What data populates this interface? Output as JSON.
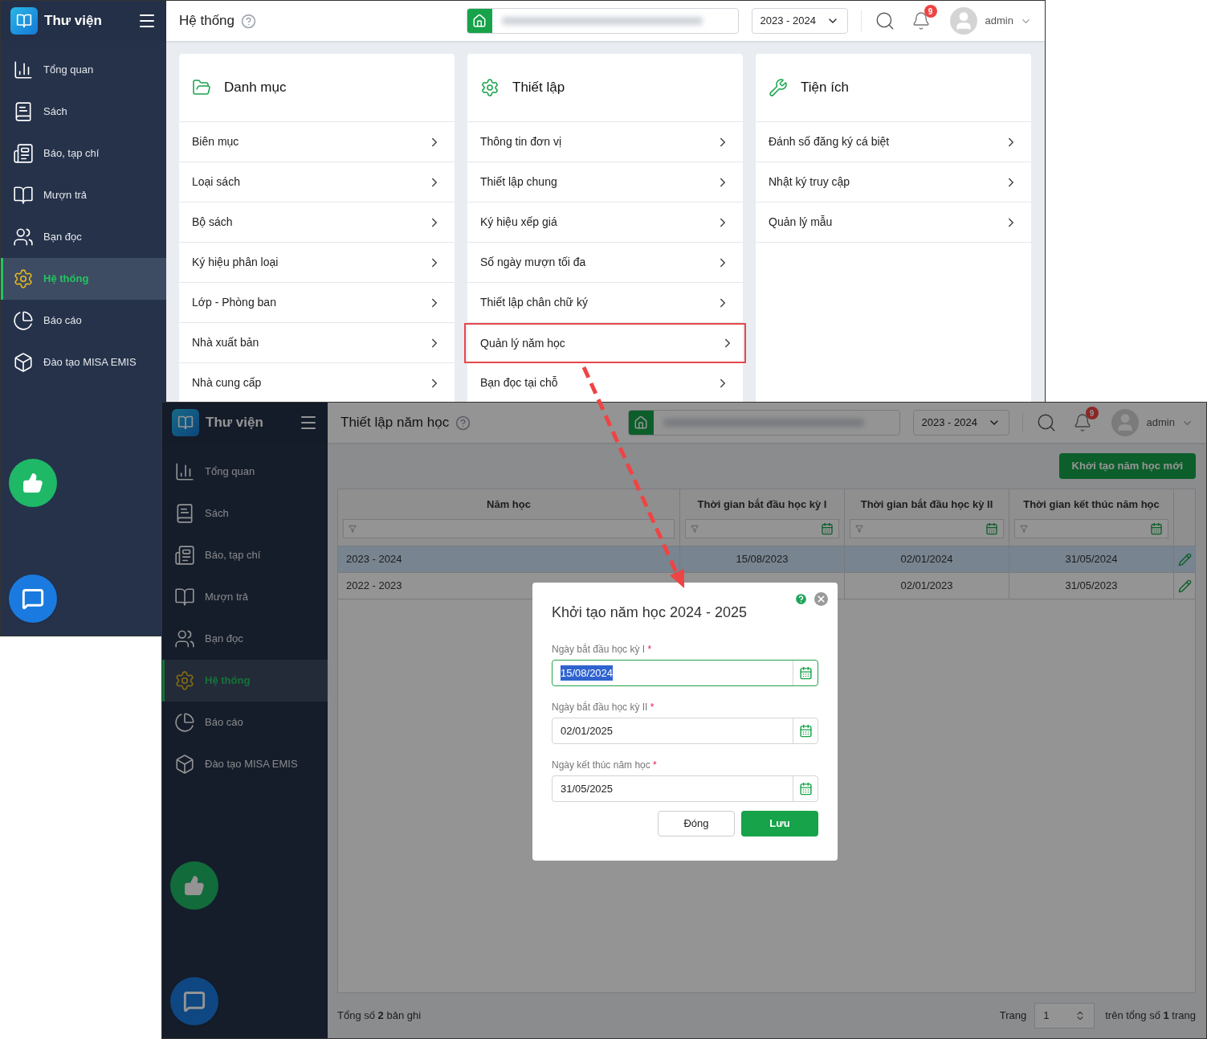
{
  "back_screen": {
    "app_title": "Thư viện",
    "page_title": "Hệ thống",
    "school_year": "2023 - 2024",
    "notification_count": "9",
    "user": "admin",
    "sidebar": [
      {
        "label": "Tổng quan",
        "selected": false
      },
      {
        "label": "Sách",
        "selected": false
      },
      {
        "label": "Báo, tạp chí",
        "selected": false
      },
      {
        "label": "Mượn trả",
        "selected": false
      },
      {
        "label": "Bạn đọc",
        "selected": false
      },
      {
        "label": "Hệ thống",
        "selected": true
      },
      {
        "label": "Báo cáo",
        "selected": false
      },
      {
        "label": "Đào tạo MISA EMIS",
        "selected": false
      }
    ],
    "cards": [
      {
        "title": "Danh mục",
        "rows": [
          {
            "label": "Biên mục",
            "highlighted": false
          },
          {
            "label": "Loại sách",
            "highlighted": false
          },
          {
            "label": "Bộ sách",
            "highlighted": false
          },
          {
            "label": "Ký hiệu phân loại",
            "highlighted": false
          },
          {
            "label": "Lớp - Phòng ban",
            "highlighted": false
          },
          {
            "label": "Nhà xuất bản",
            "highlighted": false
          },
          {
            "label": "Nhà cung cấp",
            "highlighted": false
          }
        ]
      },
      {
        "title": "Thiết lập",
        "rows": [
          {
            "label": "Thông tin đơn vị",
            "highlighted": false
          },
          {
            "label": "Thiết lập chung",
            "highlighted": false
          },
          {
            "label": "Ký hiệu xếp giá",
            "highlighted": false
          },
          {
            "label": "Số ngày mượn tối đa",
            "highlighted": false
          },
          {
            "label": "Thiết lập chân chữ ký",
            "highlighted": false
          },
          {
            "label": "Quản lý năm học",
            "highlighted": true
          },
          {
            "label": "Bạn đọc tại chỗ",
            "highlighted": false
          }
        ]
      },
      {
        "title": "Tiện ích",
        "rows": [
          {
            "label": "Đánh số đăng ký cá biệt",
            "highlighted": false
          },
          {
            "label": "Nhật ký truy cập",
            "highlighted": false
          },
          {
            "label": "Quản lý mẫu",
            "highlighted": false
          }
        ]
      }
    ]
  },
  "front_screen": {
    "app_title": "Thư viện",
    "page_title": "Thiết lập năm học",
    "school_year": "2023 - 2024",
    "notification_count": "9",
    "user": "admin",
    "sidebar": [
      {
        "label": "Tổng quan",
        "selected": false
      },
      {
        "label": "Sách",
        "selected": false
      },
      {
        "label": "Báo, tạp chí",
        "selected": false
      },
      {
        "label": "Mượn trả",
        "selected": false
      },
      {
        "label": "Bạn đọc",
        "selected": false
      },
      {
        "label": "Hệ thống",
        "selected": true
      },
      {
        "label": "Báo cáo",
        "selected": false
      },
      {
        "label": "Đào tạo MISA EMIS",
        "selected": false
      }
    ],
    "new_button": "Khởi tạo năm học mới",
    "table": {
      "columns": [
        {
          "label": "Năm học",
          "date_filter": false
        },
        {
          "label": "Thời gian bắt đầu học kỳ I",
          "date_filter": true
        },
        {
          "label": "Thời gian bắt đầu học kỳ II",
          "date_filter": true
        },
        {
          "label": "Thời gian kết thúc năm học",
          "date_filter": true
        }
      ],
      "rows": [
        {
          "selected": true,
          "cells": [
            "2023 - 2024",
            "15/08/2023",
            "02/01/2024",
            "31/05/2024"
          ]
        },
        {
          "selected": false,
          "cells": [
            "2022 - 2023",
            null,
            "02/01/2023",
            "31/05/2023"
          ]
        }
      ]
    },
    "footer": {
      "total": "Tổng số **2** bản ghi",
      "page_label": "Trang",
      "page": "1",
      "page_total": "trên tổng số **1** trang"
    },
    "modal": {
      "title": "Khởi tạo năm học 2024 - 2025",
      "fields": [
        {
          "label": "Ngày bắt đầu học kỳ I",
          "required_mark": "*",
          "value": "15/08/2024",
          "focused": true,
          "text_selected": true
        },
        {
          "label": "Ngày bắt đầu học kỳ II",
          "required_mark": "*",
          "value": "02/01/2025",
          "focused": false,
          "text_selected": false
        },
        {
          "label": "Ngày kết thúc năm học",
          "required_mark": "*",
          "value": "31/05/2025",
          "focused": false,
          "text_selected": false
        }
      ],
      "close_button": "Đóng",
      "save_button": "Lưu"
    }
  }
}
